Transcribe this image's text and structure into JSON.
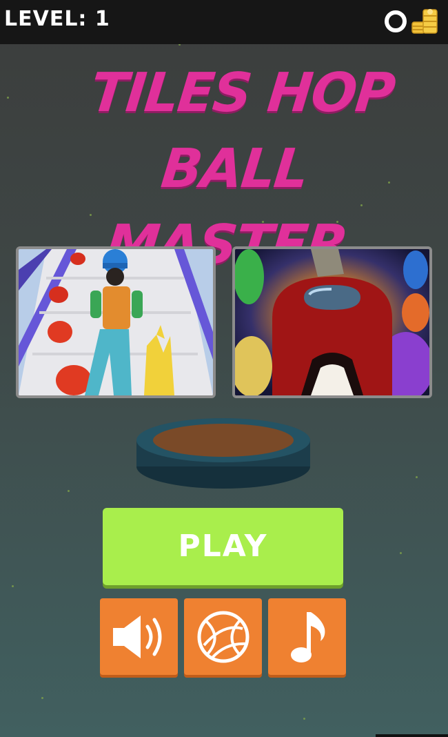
{
  "hud": {
    "level_label": "LEVEL: 1",
    "coin_icon": "coin-ring-icon",
    "coins_icon": "coin-stack-icon"
  },
  "title": {
    "line1": "TILES HOP BALL",
    "line2": "MASTER"
  },
  "promo_cards": [
    {
      "name": "runner-game-thumbnail"
    },
    {
      "name": "impostor-game-thumbnail"
    }
  ],
  "play_button": {
    "label": "PLAY"
  },
  "options": [
    {
      "name": "sound-button",
      "icon": "speaker-icon"
    },
    {
      "name": "ball-select-button",
      "icon": "basketball-icon"
    },
    {
      "name": "music-button",
      "icon": "music-note-icon"
    }
  ],
  "colors": {
    "title": "#e0309a",
    "play": "#a9ee4c",
    "option_buttons": "#ef8131",
    "topbar": "#161616"
  }
}
